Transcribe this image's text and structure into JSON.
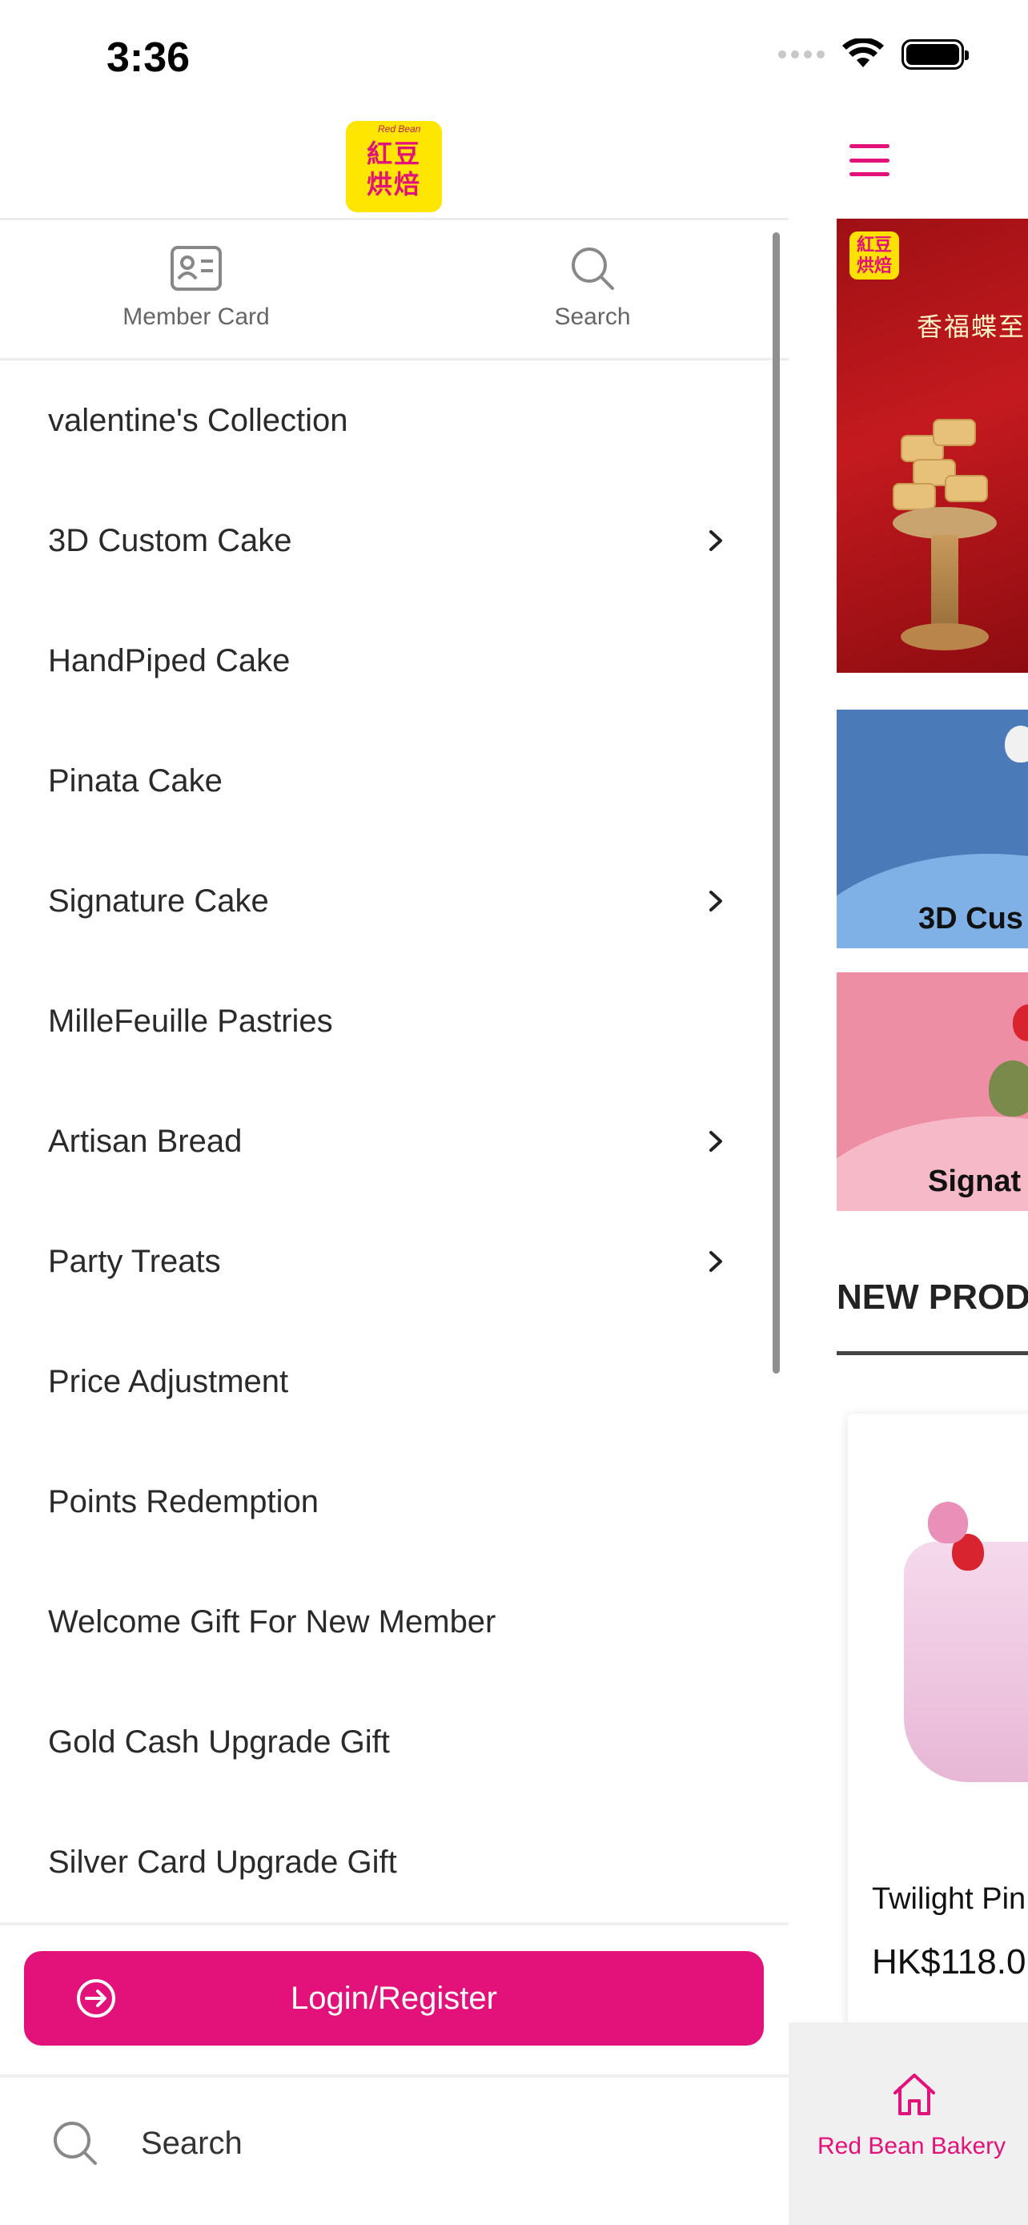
{
  "status_bar": {
    "time": "3:36",
    "icons": [
      "signal-dots-icon",
      "wifi-icon",
      "battery-icon"
    ]
  },
  "drawer": {
    "logo": {
      "icon": "red-bean-bakery-logo",
      "line1": "紅豆",
      "line2": "烘焙",
      "small_text": "Red Bean"
    },
    "quick_actions": [
      {
        "label": "Member Card",
        "icon": "member-card-icon"
      },
      {
        "label": "Search",
        "icon": "search-icon"
      }
    ],
    "menu_items": [
      {
        "label": "valentine's Collection",
        "has_submenu": false
      },
      {
        "label": "3D Custom Cake",
        "has_submenu": true
      },
      {
        "label": "HandPiped Cake",
        "has_submenu": false
      },
      {
        "label": "Pinata Cake",
        "has_submenu": false
      },
      {
        "label": "Signature Cake",
        "has_submenu": true
      },
      {
        "label": "MilleFeuille Pastries",
        "has_submenu": false
      },
      {
        "label": "Artisan Bread",
        "has_submenu": true
      },
      {
        "label": "Party Treats",
        "has_submenu": true
      },
      {
        "label": "Price Adjustment",
        "has_submenu": false
      },
      {
        "label": "Points Redemption",
        "has_submenu": false
      },
      {
        "label": "Welcome Gift For New Member",
        "has_submenu": false
      },
      {
        "label": "Gold Cash Upgrade Gift",
        "has_submenu": false
      },
      {
        "label": "Silver Card Upgrade Gift",
        "has_submenu": false
      }
    ],
    "login_button": {
      "label": "Login/Register",
      "icon": "login-arrow-icon"
    },
    "footer_search": {
      "label": "Search",
      "icon": "search-icon"
    }
  },
  "main": {
    "menu_icon": "hamburger-menu-icon",
    "banner1": {
      "title": "香福蝶至·賀"
    },
    "banner2": {
      "label": "3D Cus"
    },
    "banner3": {
      "label": "Signat"
    },
    "section_title": "NEW PROD",
    "product": {
      "name": "Twilight Pin",
      "price": "HK$118.0"
    },
    "tab_bar": {
      "label": "Red Bean Bakery",
      "icon": "home-icon"
    }
  },
  "colors": {
    "accent": "#e3127a",
    "logo_yellow": "#ffe600",
    "divider": "#ececec",
    "text": "#2a2a2a",
    "muted": "#666666",
    "tab_bar_bg": "#f0f0f0"
  }
}
